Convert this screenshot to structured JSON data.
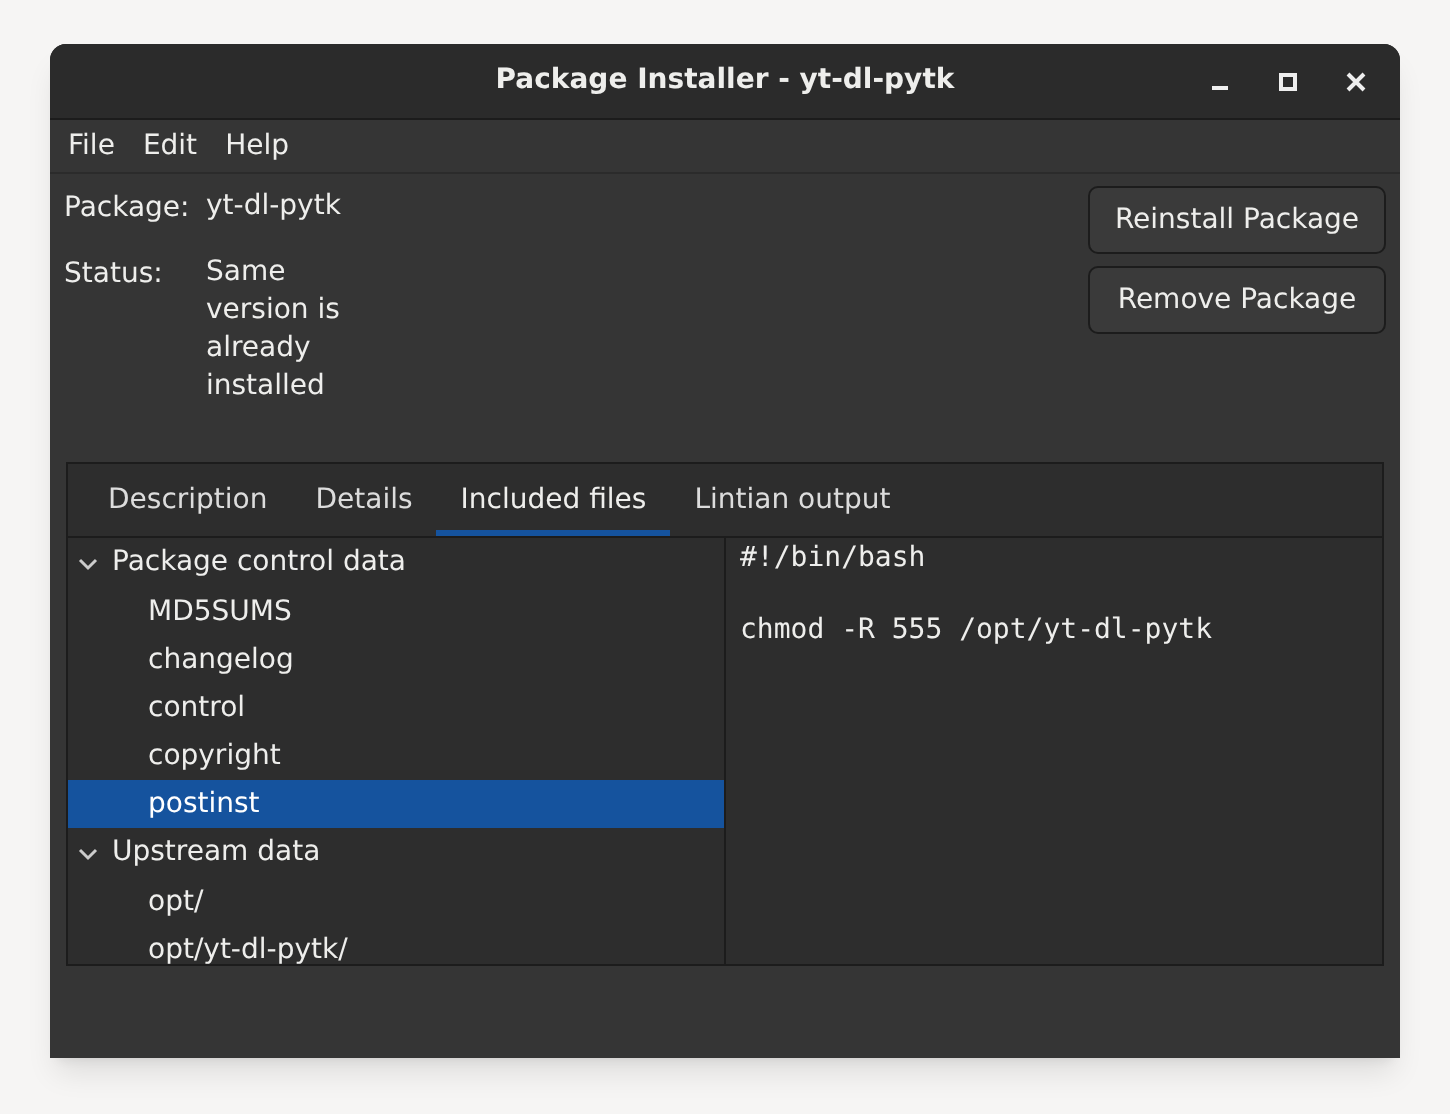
{
  "window": {
    "title": "Package Installer - yt-dl-pytk"
  },
  "menu": [
    "File",
    "Edit",
    "Help"
  ],
  "info": [
    {
      "label": "Package:",
      "value": "yt-dl-pytk"
    },
    {
      "label": "Status:",
      "value": "Same version is already installed"
    }
  ],
  "buttons": [
    "Reinstall Package",
    "Remove Package"
  ],
  "tabs": [
    {
      "label": "Description",
      "selected": false
    },
    {
      "label": "Details",
      "selected": false
    },
    {
      "label": "Included files",
      "selected": true
    },
    {
      "label": "Lintian output",
      "selected": false
    }
  ],
  "tree": [
    {
      "label": "Package control data",
      "expanded": true,
      "children": [
        {
          "label": "MD5SUMS",
          "selected": false
        },
        {
          "label": "changelog",
          "selected": false
        },
        {
          "label": "control",
          "selected": false
        },
        {
          "label": "copyright",
          "selected": false
        },
        {
          "label": "postinst",
          "selected": true
        }
      ]
    },
    {
      "label": "Upstream data",
      "expanded": true,
      "children": [
        {
          "label": "opt/",
          "selected": false
        },
        {
          "label": "opt/yt-dl-pytk/",
          "selected": false
        }
      ]
    }
  ],
  "file_content": [
    "#!/bin/bash",
    "chmod -R 555 /opt/yt-dl-pytk"
  ]
}
